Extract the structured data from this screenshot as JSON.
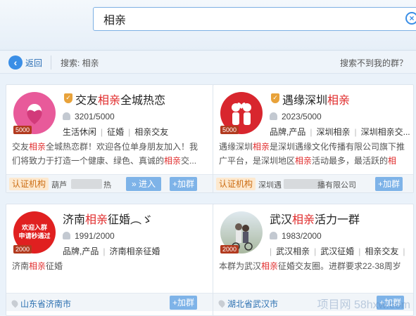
{
  "search": {
    "query": "相亲"
  },
  "subbar": {
    "back_label": "返回",
    "crumb": "搜索: 相亲",
    "not_found": "搜索不到我的群？"
  },
  "cards": [
    {
      "name_pre": "交友",
      "name_hl": "相亲",
      "name_post": "全城热恋",
      "members": "3201/5000",
      "cap": "5000",
      "tags": [
        "生活休闲",
        "征婚",
        "相亲交友"
      ],
      "desc1_pre": "交友",
      "desc1_hl": "相亲",
      "desc1_post": "全城热恋群！欢迎各位单身朋友加入！我",
      "desc2_pre": "们将致力于打造一个健康、绿色、真诚的",
      "desc2_hl": "相亲",
      "desc2_post": "交...",
      "cert": "认证机构",
      "owner_pre": "葫芦",
      "owner_post": "热",
      "enter": "» 进入",
      "join": "+加群"
    },
    {
      "name_pre": "遇缘深圳",
      "name_hl": "相亲",
      "name_post": "",
      "members": "2023/5000",
      "cap": "5000",
      "tags": [
        "品牌,产品",
        "深圳相亲",
        "深圳相亲交..."
      ],
      "desc1_pre": "遇缘深圳",
      "desc1_hl": "相亲",
      "desc1_post": "是深圳遇缘文化传播有限公司旗下推",
      "desc2_pre": "广平台，是深圳地区",
      "desc2_hl": "相亲",
      "desc2_post": "活动最多，最活跃的",
      "desc2_tail": "相",
      "cert": "认证机构",
      "owner_pre": "深圳遇",
      "owner_post": "播有限公司",
      "join": "+加群"
    },
    {
      "name_pre": "济南",
      "name_hl": "相亲",
      "name_post": "征婚︵ゞ",
      "members": "1991/2000",
      "cap": "2000",
      "tags": [
        "品牌,产品",
        "济南相亲征婚"
      ],
      "desc1_pre": "济南",
      "desc1_hl": "相亲",
      "desc1_post": "征婚",
      "location": "山东省济南市",
      "join": "+加群",
      "avatar_line1": "欢迎入群",
      "avatar_line2": "申请秒通过"
    },
    {
      "name_pre": "武汉",
      "name_hl": "相亲",
      "name_post": "活力一群",
      "members": "1983/2000",
      "cap": "2000",
      "tags": [
        "武汉相亲",
        "武汉征婚",
        "相亲交友"
      ],
      "desc1_pre": "本群为武汉",
      "desc1_hl": "相亲",
      "desc1_post": "征婚交友圈。进群要求22-38周岁",
      "location": "湖北省武汉市",
      "join": "+加群"
    }
  ],
  "watermark": "项目网 58hxw.com"
}
